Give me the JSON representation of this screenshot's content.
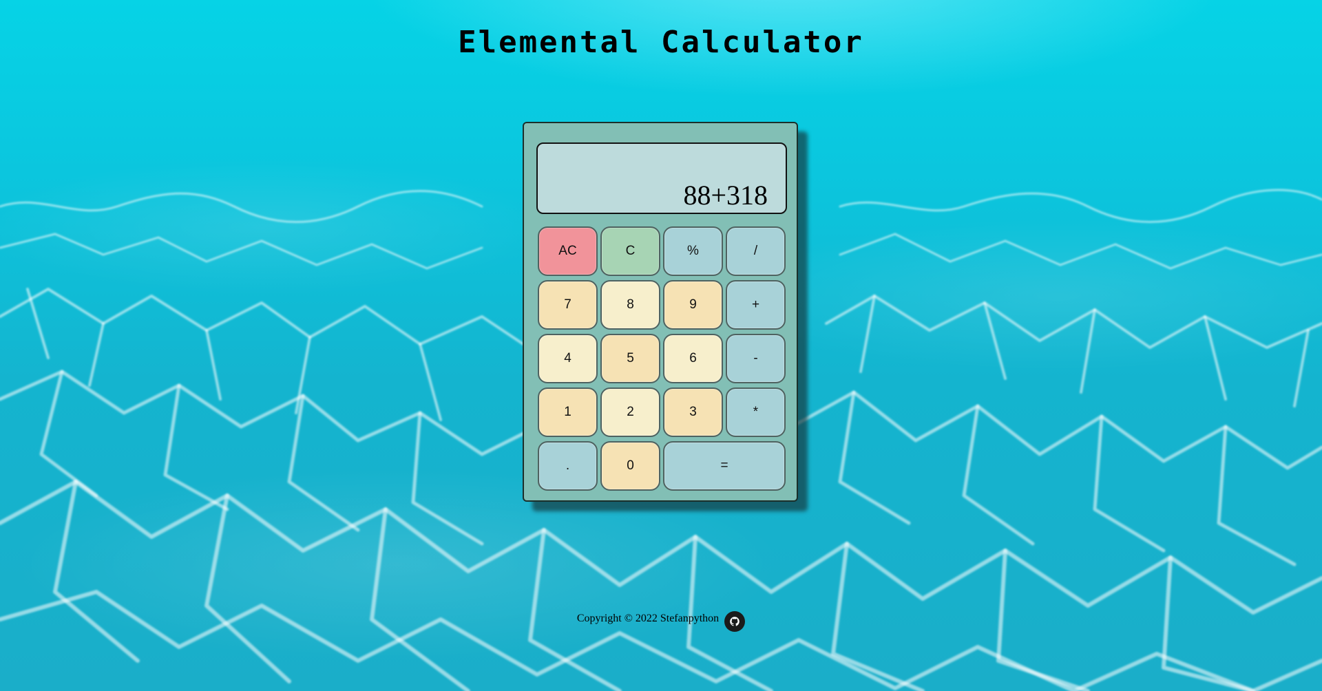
{
  "page": {
    "title": "Elemental Calculator"
  },
  "calculator": {
    "display_value": "88+318",
    "keys": [
      {
        "label": "AC",
        "name": "all-clear-button",
        "color": "#f1939a",
        "wide": false
      },
      {
        "label": "C",
        "name": "clear-button",
        "color": "#a7d4b4",
        "wide": false
      },
      {
        "label": "%",
        "name": "percent-button",
        "color": "#a8d2d8",
        "wide": false
      },
      {
        "label": "/",
        "name": "divide-button",
        "color": "#a8d2d8",
        "wide": false
      },
      {
        "label": "7",
        "name": "digit-7-button",
        "color": "#f6e2b4",
        "wide": false
      },
      {
        "label": "8",
        "name": "digit-8-button",
        "color": "#f7efcc",
        "wide": false
      },
      {
        "label": "9",
        "name": "digit-9-button",
        "color": "#f6e2b4",
        "wide": false
      },
      {
        "label": "+",
        "name": "add-button",
        "color": "#a8d2d8",
        "wide": false
      },
      {
        "label": "4",
        "name": "digit-4-button",
        "color": "#f7efcc",
        "wide": false
      },
      {
        "label": "5",
        "name": "digit-5-button",
        "color": "#f6e2b4",
        "wide": false
      },
      {
        "label": "6",
        "name": "digit-6-button",
        "color": "#f7efcc",
        "wide": false
      },
      {
        "label": "-",
        "name": "subtract-button",
        "color": "#a8d2d8",
        "wide": false
      },
      {
        "label": "1",
        "name": "digit-1-button",
        "color": "#f6e2b4",
        "wide": false
      },
      {
        "label": "2",
        "name": "digit-2-button",
        "color": "#f7efcc",
        "wide": false
      },
      {
        "label": "3",
        "name": "digit-3-button",
        "color": "#f6e2b4",
        "wide": false
      },
      {
        "label": "*",
        "name": "multiply-button",
        "color": "#a8d2d8",
        "wide": false
      },
      {
        "label": ".",
        "name": "decimal-button",
        "color": "#a8d2d8",
        "wide": false
      },
      {
        "label": "0",
        "name": "digit-0-button",
        "color": "#f6e2b4",
        "wide": false
      },
      {
        "label": "=",
        "name": "equals-button",
        "color": "#a8d2d8",
        "wide": true
      }
    ]
  },
  "footer": {
    "copyright": "Copyright © 2022 Stefanpython",
    "github_icon": "github-icon"
  },
  "colors": {
    "background": "#00c4dc",
    "calculator_body": "#82bfb5",
    "display": "#bddbdc"
  }
}
